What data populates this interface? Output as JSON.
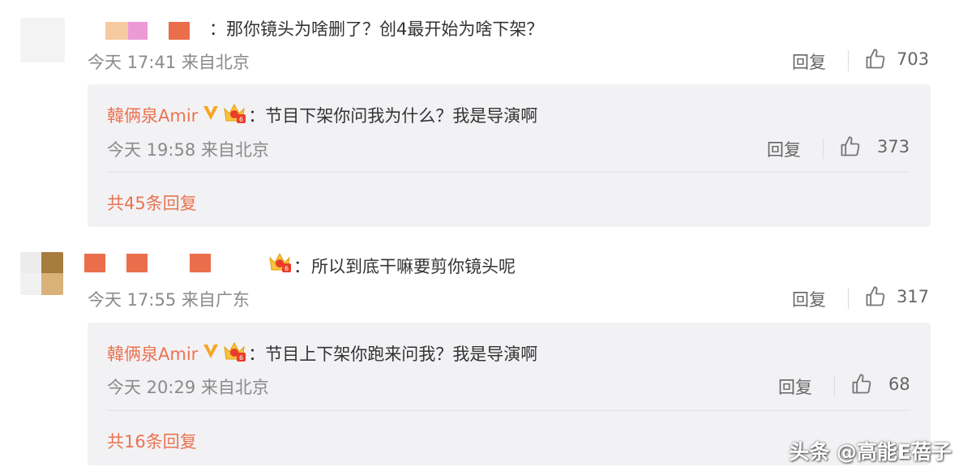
{
  "comments": [
    {
      "text": "：那你镜头为啥删了？创4最开始为啥下架？",
      "time": "今天 17:41 来自北京",
      "reply_label": "回复",
      "likes": "703",
      "reply": {
        "author": "韓俩泉Amir",
        "text": "：节目下架你问我为什么？我是导演啊",
        "time": "今天 19:58 来自北京",
        "reply_label": "回复",
        "likes": "373"
      },
      "more_replies": "共45条回复"
    },
    {
      "text": "所以到底干嘛要剪你镜头呢",
      "time": "今天 17:55 来自广东",
      "reply_label": "回复",
      "likes": "317",
      "reply": {
        "author": "韓俩泉Amir",
        "text": "：节目上下架你跑来问我？我是导演啊",
        "time": "今天 20:29 来自北京",
        "reply_label": "回复",
        "likes": "68"
      },
      "more_replies": "共16条回复"
    }
  ],
  "watermark": "头条 @高能E蓓子",
  "colors": {
    "accent": "#eb7350",
    "reply_bg": "#f2f2f5",
    "meta_gray": "#8a8a8a",
    "verified_gold": "#f5a623"
  },
  "icons": [
    "thumbs-up-icon",
    "verified-v-icon",
    "vip-crown-icon"
  ]
}
